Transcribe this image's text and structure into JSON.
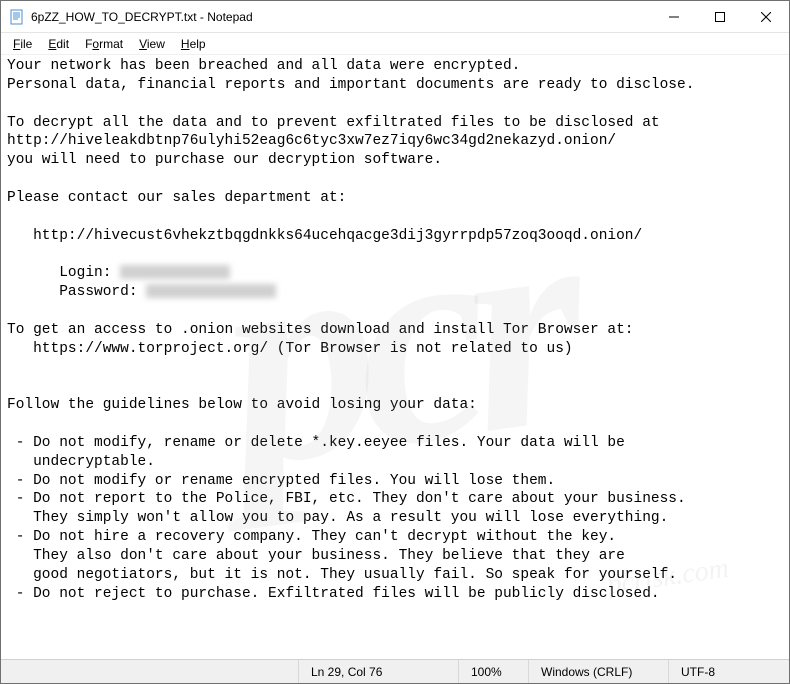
{
  "titlebar": {
    "title": "6pZZ_HOW_TO_DECRYPT.txt - Notepad"
  },
  "menu": {
    "file": "File",
    "edit": "Edit",
    "format": "Format",
    "view": "View",
    "help": "Help"
  },
  "content": {
    "line1": "Your network has been breached and all data were encrypted.",
    "line2": "Personal data, financial reports and important documents are ready to disclose.",
    "blank1": "",
    "line3": "To decrypt all the data and to prevent exfiltrated files to be disclosed at",
    "line4": "http://hiveleakdbtnp76ulyhi52eag6c6tyc3xw7ez7iqy6wc34gd2nekazyd.onion/",
    "line5": "you will need to purchase our decryption software.",
    "blank2": "",
    "line6": "Please contact our sales department at:",
    "blank3": "",
    "line7": "   http://hivecust6vhekztbqgdnkks64ucehqacge3dij3gyrrpdp57zoq3ooqd.onion/",
    "blank4": "",
    "login_lbl": "      Login: ",
    "pass_lbl": "      Password: ",
    "blank5": "",
    "line8": "To get an access to .onion websites download and install Tor Browser at:",
    "line9": "   https://www.torproject.org/ (Tor Browser is not related to us)",
    "blank6": "",
    "blank7": "",
    "line10": "Follow the guidelines below to avoid losing your data:",
    "blank8": "",
    "g1a": " - Do not modify, rename or delete *.key.eeyee files. Your data will be",
    "g1b": "   undecryptable.",
    "g2": " - Do not modify or rename encrypted files. You will lose them.",
    "g3a": " - Do not report to the Police, FBI, etc. They don't care about your business.",
    "g3b": "   They simply won't allow you to pay. As a result you will lose everything.",
    "g4a": " - Do not hire a recovery company. They can't decrypt without the key.",
    "g4b": "   They also don't care about your business. They believe that they are",
    "g4c": "   good negotiators, but it is not. They usually fail. So speak for yourself.",
    "g5": " - Do not reject to purchase. Exfiltrated files will be publicly disclosed."
  },
  "statusbar": {
    "position": "Ln 29, Col 76",
    "zoom": "100%",
    "line_ending": "Windows (CRLF)",
    "encoding": "UTF-8"
  },
  "watermark": {
    "main": "pcr",
    "sub": "pcrisk.com"
  }
}
